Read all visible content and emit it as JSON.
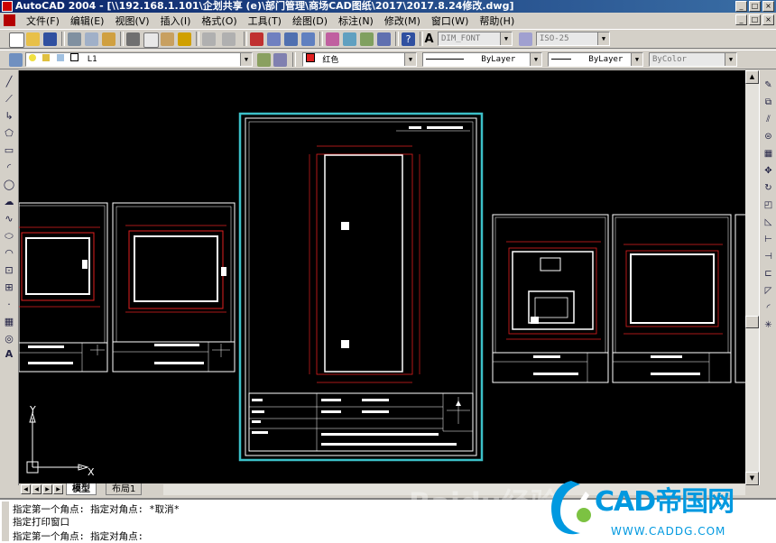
{
  "window": {
    "title": "AutoCAD 2004 - [\\\\192.168.1.101\\企划共享 (e)\\部门管理\\商场CAD图纸\\2017\\2017.8.24修改.dwg]",
    "controls": [
      "_",
      "□",
      "×"
    ]
  },
  "menubar": {
    "items": [
      "文件(F)",
      "编辑(E)",
      "视图(V)",
      "插入(I)",
      "格式(O)",
      "工具(T)",
      "绘图(D)",
      "标注(N)",
      "修改(M)",
      "窗口(W)",
      "帮助(H)"
    ],
    "doc_controls": [
      "_",
      "□",
      "×"
    ]
  },
  "toolbar_standard": {
    "text_style": "DIM_FONT",
    "dim_style": "ISO-25"
  },
  "toolbar_layers": {
    "layer": "L1",
    "color": "红色",
    "linetype": "ByLayer",
    "lineweight": "ByLayer",
    "plotstyle": "ByColor"
  },
  "canvas": {
    "ucs": {
      "x_label": "X",
      "y_label": "Y"
    }
  },
  "tabs": {
    "model": "模型",
    "layout1": "布局1"
  },
  "command_lines": [
    "指定第一个角点: 指定对角点: *取消*",
    "指定打印窗口",
    "指定第一个角点: 指定对角点:"
  ],
  "watermark": {
    "text": "CAD帝国网",
    "url": "WWW.CADDG.COM",
    "ghost": "Baidu经验"
  },
  "colors": {
    "accent_titlebar": "#0a246a",
    "canvas_bg": "#000000",
    "selection_frame": "#3cc0c8",
    "drawing_red": "#e02020",
    "watermark": "#0099e0"
  }
}
